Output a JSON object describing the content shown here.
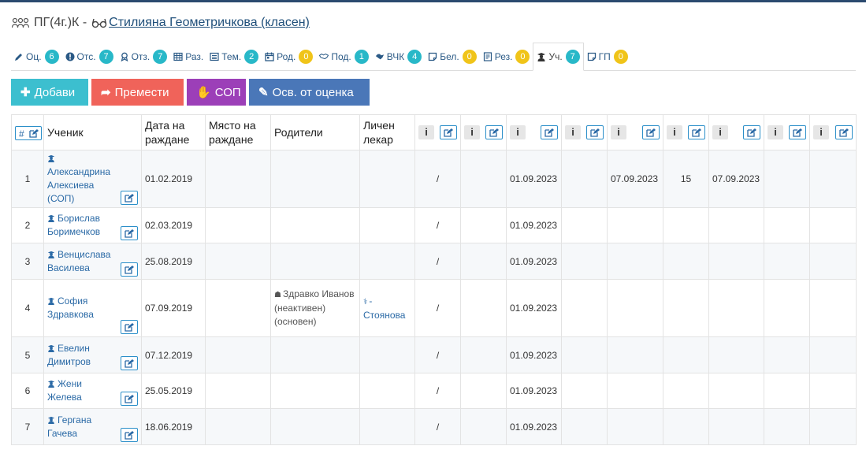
{
  "header": {
    "class_name": "ПГ(4г.)К -",
    "teacher": "Стилияна Геометричкова (класен)"
  },
  "tabs": [
    {
      "id": "grades",
      "icon": "pencil-icon",
      "label": "Оц.",
      "count": "6",
      "color": "teal"
    },
    {
      "id": "absences",
      "icon": "exclamation-circle-icon",
      "label": "Отс.",
      "count": "7",
      "color": "teal"
    },
    {
      "id": "feedback",
      "icon": "award-icon",
      "label": "Отз.",
      "count": "7",
      "color": "teal"
    },
    {
      "id": "schedule",
      "icon": "table-icon",
      "label": "Раз.",
      "count": "",
      "color": ""
    },
    {
      "id": "topics",
      "icon": "list-icon",
      "label": "Тем.",
      "count": "2",
      "color": "teal"
    },
    {
      "id": "parents",
      "icon": "calendar-icon",
      "label": "Род.",
      "count": "0",
      "color": "yellow"
    },
    {
      "id": "support",
      "icon": "handshake-icon",
      "label": "Под.",
      "count": "1",
      "color": "teal"
    },
    {
      "id": "vchk",
      "icon": "handshake-alt-icon",
      "label": "ВЧК",
      "count": "4",
      "color": "teal"
    },
    {
      "id": "notes",
      "icon": "note-icon",
      "label": "Бел.",
      "count": "0",
      "color": "yellow"
    },
    {
      "id": "results",
      "icon": "doc-icon",
      "label": "Рез.",
      "count": "0",
      "color": "yellow"
    },
    {
      "id": "students",
      "icon": "student-icon",
      "label": "Уч.",
      "count": "7",
      "color": "teal",
      "active": true
    },
    {
      "id": "gp",
      "icon": "note-icon",
      "label": "ГП",
      "count": "0",
      "color": "yellow"
    }
  ],
  "actions": {
    "add": "Добави",
    "move": "Премести",
    "sop": "СОП",
    "exempt": "Осв. от оценка"
  },
  "table": {
    "headers": {
      "num": "#",
      "student": "Ученик",
      "birth_date": "Дата на раждане",
      "birth_place": "Място на раждане",
      "parents": "Родители",
      "doctor": "Личен лекар"
    },
    "rows": [
      {
        "n": "1",
        "name": "Александрина Алексиева (СОП)",
        "birth": "01.02.2019",
        "place": "",
        "parents": "",
        "doctor": "",
        "c1": "/",
        "c2": "",
        "c3": "01.09.2023",
        "c4": "",
        "c5": "07.09.2023",
        "c6": "15",
        "c7": "07.09.2023",
        "c8": "",
        "c9": ""
      },
      {
        "n": "2",
        "name": "Борислав Боримечков",
        "birth": "02.03.2019",
        "place": "",
        "parents": "",
        "doctor": "",
        "c1": "/",
        "c2": "",
        "c3": "01.09.2023",
        "c4": "",
        "c5": "",
        "c6": "",
        "c7": "",
        "c8": "",
        "c9": ""
      },
      {
        "n": "3",
        "name": "Венцислава Василева",
        "birth": "25.08.2019",
        "place": "",
        "parents": "",
        "doctor": "",
        "c1": "/",
        "c2": "",
        "c3": "01.09.2023",
        "c4": "",
        "c5": "",
        "c6": "",
        "c7": "",
        "c8": "",
        "c9": ""
      },
      {
        "n": "4",
        "name": "София Здравкова",
        "birth": "07.09.2019",
        "place": "",
        "parents": "Здравко Иванов (неактивен) (основен)",
        "doctor": "- Стоянова",
        "c1": "/",
        "c2": "",
        "c3": "01.09.2023",
        "c4": "",
        "c5": "",
        "c6": "",
        "c7": "",
        "c8": "",
        "c9": ""
      },
      {
        "n": "5",
        "name": "Евелин Димитров",
        "birth": "07.12.2019",
        "place": "",
        "parents": "",
        "doctor": "",
        "c1": "/",
        "c2": "",
        "c3": "01.09.2023",
        "c4": "",
        "c5": "",
        "c6": "",
        "c7": "",
        "c8": "",
        "c9": ""
      },
      {
        "n": "6",
        "name": "Жени Желева",
        "birth": "25.05.2019",
        "place": "",
        "parents": "",
        "doctor": "",
        "c1": "/",
        "c2": "",
        "c3": "01.09.2023",
        "c4": "",
        "c5": "",
        "c6": "",
        "c7": "",
        "c8": "",
        "c9": ""
      },
      {
        "n": "7",
        "name": "Гергана Гачева",
        "birth": "18.06.2019",
        "place": "",
        "parents": "",
        "doctor": "",
        "c1": "/",
        "c2": "",
        "c3": "01.09.2023",
        "c4": "",
        "c5": "",
        "c6": "",
        "c7": "",
        "c8": "",
        "c9": ""
      }
    ]
  },
  "colors": {
    "teal": "#28b8c8",
    "yellow": "#f0c419",
    "link": "#2b6aa6",
    "add": "#3cbfcf",
    "move": "#f0635a",
    "sop": "#9c3fb8",
    "exempt": "#4a77b8"
  }
}
